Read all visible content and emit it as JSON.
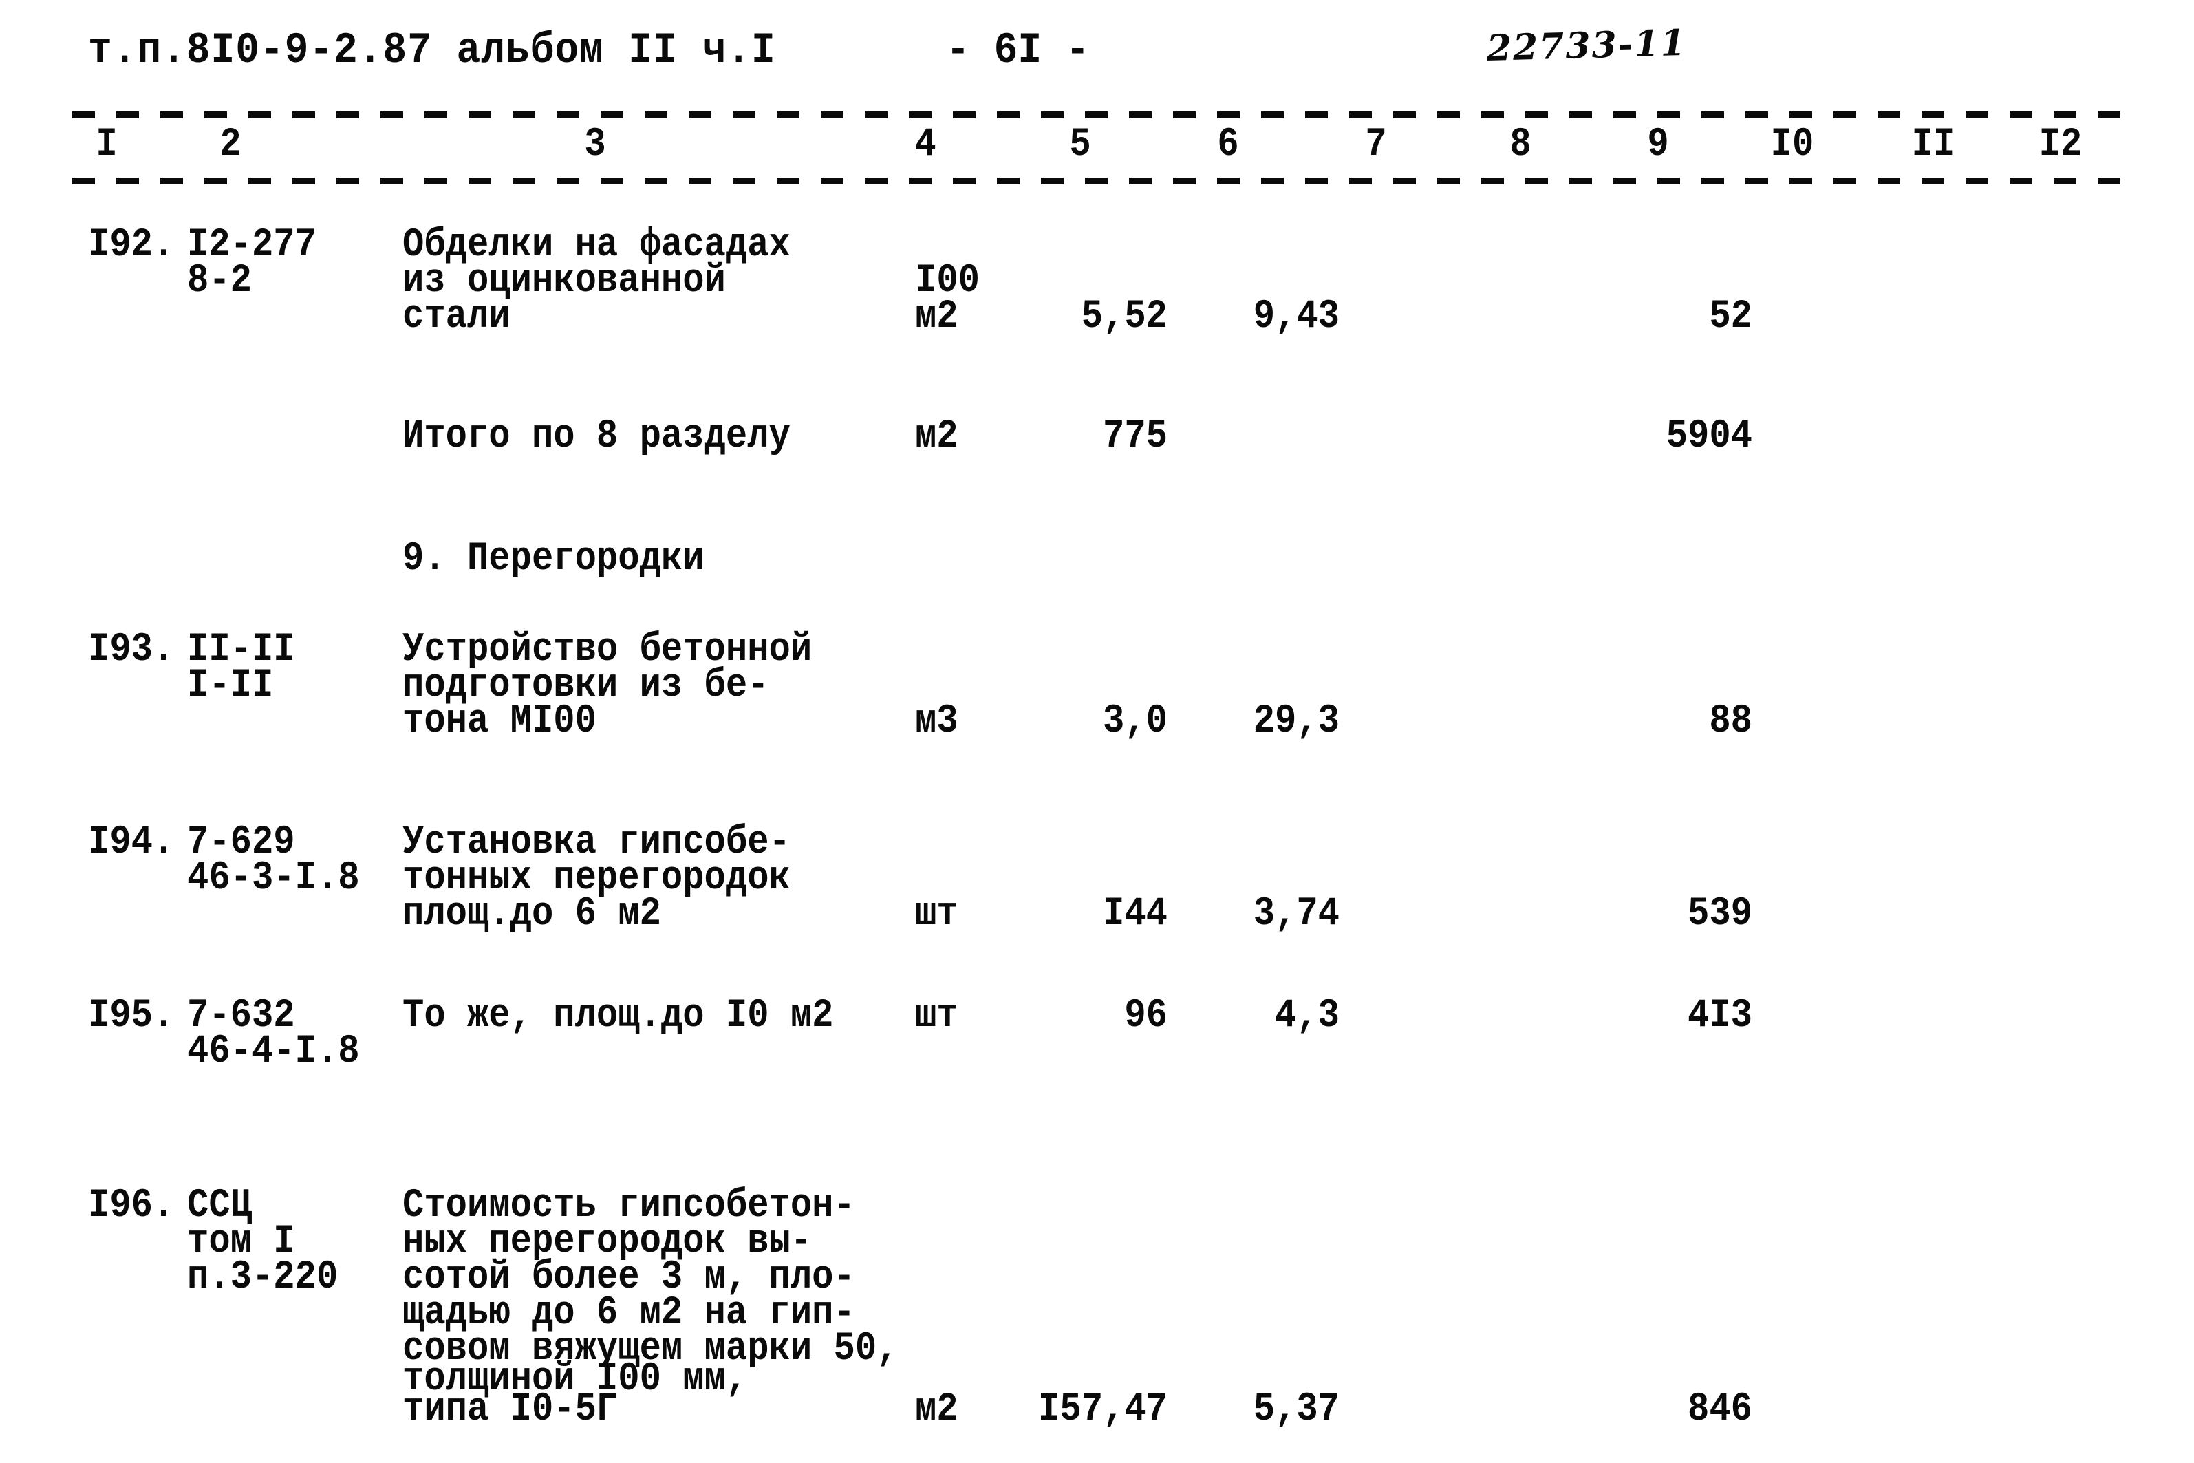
{
  "header": {
    "doc_code": "т.п.8I0-9-2.87 альбом II ч.I",
    "page_number": "- 6I -",
    "archive_stamp": "22733-11"
  },
  "table": {
    "column_numbers": [
      "I",
      "2",
      "3",
      "4",
      "5",
      "6",
      "7",
      "8",
      "9",
      "I0",
      "II",
      "I2"
    ],
    "rows": [
      {
        "no": "I92.",
        "code_lines": [
          "I2-277",
          "8-2"
        ],
        "desc_lines": [
          "Обделки на фасадах",
          "из оцинкованной",
          "стали"
        ],
        "unit_lines": [
          "I00",
          "м2"
        ],
        "c5": "5,52",
        "c6": "9,43",
        "c7": "",
        "c8": "",
        "c9": "52",
        "c10": "",
        "c11": "",
        "c12": ""
      },
      {
        "no": "",
        "code_lines": [],
        "desc_lines": [
          "Итого по 8 разделу"
        ],
        "unit_lines": [
          "м2"
        ],
        "c5": "775",
        "c6": "",
        "c7": "",
        "c8": "",
        "c9": "5904",
        "c10": "",
        "c11": "",
        "c12": ""
      },
      {
        "no": "I93.",
        "code_lines": [
          "II-II",
          "I-II"
        ],
        "desc_lines": [
          "Устройство бетонной",
          "подготовки из бе-",
          "тона MI00"
        ],
        "unit_lines": [
          "м3"
        ],
        "c5": "3,0",
        "c6": "29,3",
        "c7": "",
        "c8": "",
        "c9": "88",
        "c10": "",
        "c11": "",
        "c12": ""
      },
      {
        "no": "I94.",
        "code_lines": [
          "7-629",
          "46-3-I.8"
        ],
        "desc_lines": [
          "Установка гипсобе-",
          "тонных перегородок",
          "площ.до 6 м2"
        ],
        "unit_lines": [
          "шт"
        ],
        "c5": "I44",
        "c6": "3,74",
        "c7": "",
        "c8": "",
        "c9": "539",
        "c10": "",
        "c11": "",
        "c12": ""
      },
      {
        "no": "I95.",
        "code_lines": [
          "7-632",
          "46-4-I.8"
        ],
        "desc_lines": [
          "То же, площ.до I0 м2"
        ],
        "unit_lines": [
          "шт"
        ],
        "c5": "96",
        "c6": "4,3",
        "c7": "",
        "c8": "",
        "c9": "4I3",
        "c10": "",
        "c11": "",
        "c12": ""
      },
      {
        "no": "I96.",
        "code_lines": [
          "ССЦ",
          "том I",
          "п.3-220"
        ],
        "desc_lines": [
          "Стоимость гипсобетон-",
          "ных перегородок вы-",
          "сотой более 3 м, пло-",
          "щадью до 6 м2 на гип-",
          "совом вяжущем марки 50,",
          "толщиной I00 мм,",
          "типа I0-5Г"
        ],
        "unit_lines": [
          "м2"
        ],
        "c5": "I57,47",
        "c6": "5,37",
        "c7": "",
        "c8": "",
        "c9": "846",
        "c10": "",
        "c11": "",
        "c12": ""
      }
    ],
    "section_heading": "9. Перегородки"
  }
}
